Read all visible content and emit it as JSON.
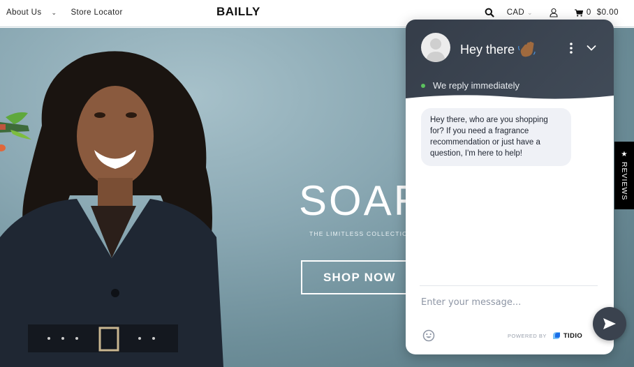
{
  "header": {
    "nav_left": [
      {
        "label": "About Us",
        "has_dropdown": true
      },
      {
        "label": "Store Locator",
        "has_dropdown": false
      }
    ],
    "logo": "BAILLY",
    "search_icon": "search-icon",
    "currency": "CAD",
    "account_icon": "user-icon",
    "cart": {
      "count": "0",
      "total": "$0.00",
      "icon": "cart-icon"
    }
  },
  "hero": {
    "title": "SOAR",
    "subtitle": "THE LIMITLESS COLLECTION",
    "cta_label": "SHOP NOW"
  },
  "reviews_tab": {
    "label": "★ REVIEWS"
  },
  "chat": {
    "title": "Hey there",
    "title_emoji": "waving-hand",
    "status_text": "We reply immediately",
    "status_color": "#5bc25e",
    "header_color": "#3a424e",
    "messages": [
      {
        "from": "agent",
        "text": "Hey there, who are you shopping for? If you need a fragrance recommendation or just have a question, I'm here to help!"
      }
    ],
    "input_placeholder": "Enter your message...",
    "powered_by": "POWERED BY",
    "brand": "TIDIO"
  }
}
